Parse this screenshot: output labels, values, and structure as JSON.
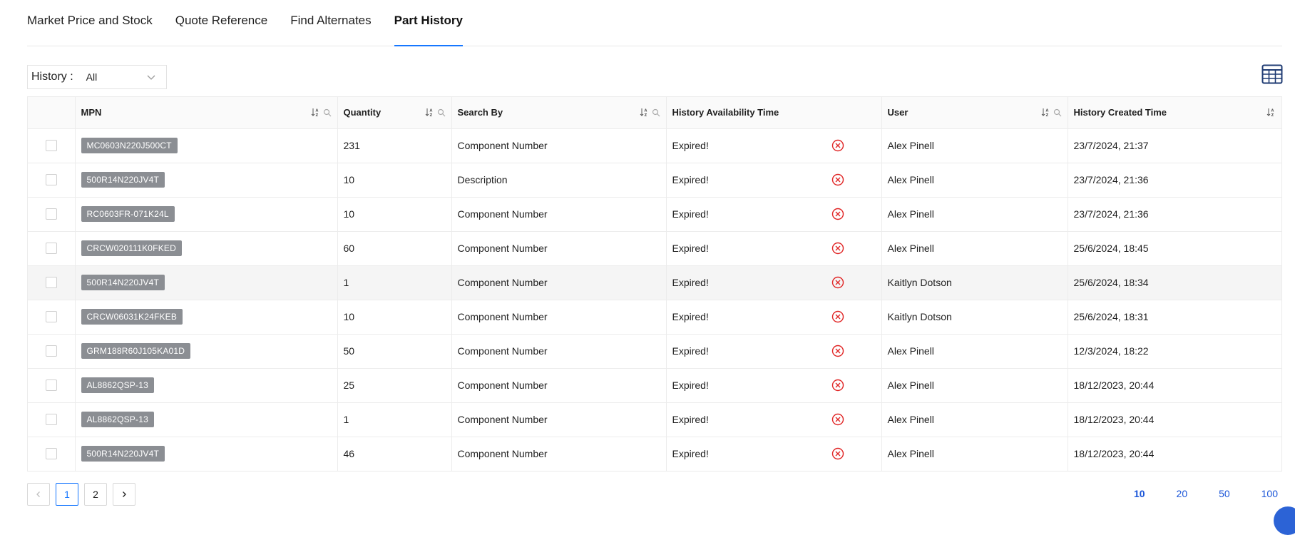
{
  "tabs": [
    {
      "label": "Market Price and Stock",
      "active": false
    },
    {
      "label": "Quote Reference",
      "active": false
    },
    {
      "label": "Find Alternates",
      "active": false
    },
    {
      "label": "Part History",
      "active": true
    }
  ],
  "filter": {
    "label": "History :",
    "value": "All"
  },
  "table": {
    "columns": [
      "MPN",
      "Quantity",
      "Search By",
      "History Availability Time",
      "User",
      "History Created Time"
    ],
    "rows": [
      {
        "mpn": "MC0603N220J500CT",
        "quantity": "231",
        "search_by": "Component Number",
        "availability": "Expired!",
        "user": "Alex Pinell",
        "created": "23/7/2024, 21:37"
      },
      {
        "mpn": "500R14N220JV4T",
        "quantity": "10",
        "search_by": "Description",
        "availability": "Expired!",
        "user": "Alex Pinell",
        "created": "23/7/2024, 21:36"
      },
      {
        "mpn": "RC0603FR-071K24L",
        "quantity": "10",
        "search_by": "Component Number",
        "availability": "Expired!",
        "user": "Alex Pinell",
        "created": "23/7/2024, 21:36"
      },
      {
        "mpn": "CRCW020111K0FKED",
        "quantity": "60",
        "search_by": "Component Number",
        "availability": "Expired!",
        "user": "Alex Pinell",
        "created": "25/6/2024, 18:45"
      },
      {
        "mpn": "500R14N220JV4T",
        "quantity": "1",
        "search_by": "Component Number",
        "availability": "Expired!",
        "user": "Kaitlyn Dotson",
        "created": "25/6/2024, 18:34"
      },
      {
        "mpn": "CRCW06031K24FKEB",
        "quantity": "10",
        "search_by": "Component Number",
        "availability": "Expired!",
        "user": "Kaitlyn Dotson",
        "created": "25/6/2024, 18:31"
      },
      {
        "mpn": "GRM188R60J105KA01D",
        "quantity": "50",
        "search_by": "Component Number",
        "availability": "Expired!",
        "user": "Alex Pinell",
        "created": "12/3/2024, 18:22"
      },
      {
        "mpn": "AL8862QSP-13",
        "quantity": "25",
        "search_by": "Component Number",
        "availability": "Expired!",
        "user": "Alex Pinell",
        "created": "18/12/2023, 20:44"
      },
      {
        "mpn": "AL8862QSP-13",
        "quantity": "1",
        "search_by": "Component Number",
        "availability": "Expired!",
        "user": "Alex Pinell",
        "created": "18/12/2023, 20:44"
      },
      {
        "mpn": "500R14N220JV4T",
        "quantity": "46",
        "search_by": "Component Number",
        "availability": "Expired!",
        "user": "Alex Pinell",
        "created": "18/12/2023, 20:44"
      }
    ]
  },
  "pagination": {
    "pages": [
      "1",
      "2"
    ],
    "current": "1"
  },
  "page_sizes": {
    "options": [
      "10",
      "20",
      "50",
      "100"
    ],
    "current": "10"
  },
  "icons": {
    "sort": "sort-icon",
    "search": "search-icon",
    "expired": "close-circle-icon",
    "grid": "table-grid-icon",
    "prev": "chevron-left-icon",
    "next": "chevron-right-icon",
    "dropdown": "chevron-down-icon"
  },
  "colors": {
    "accent": "#1677ff",
    "expired": "#e02424",
    "tag_bg": "#8b8e93",
    "link": "#1a55d8"
  }
}
